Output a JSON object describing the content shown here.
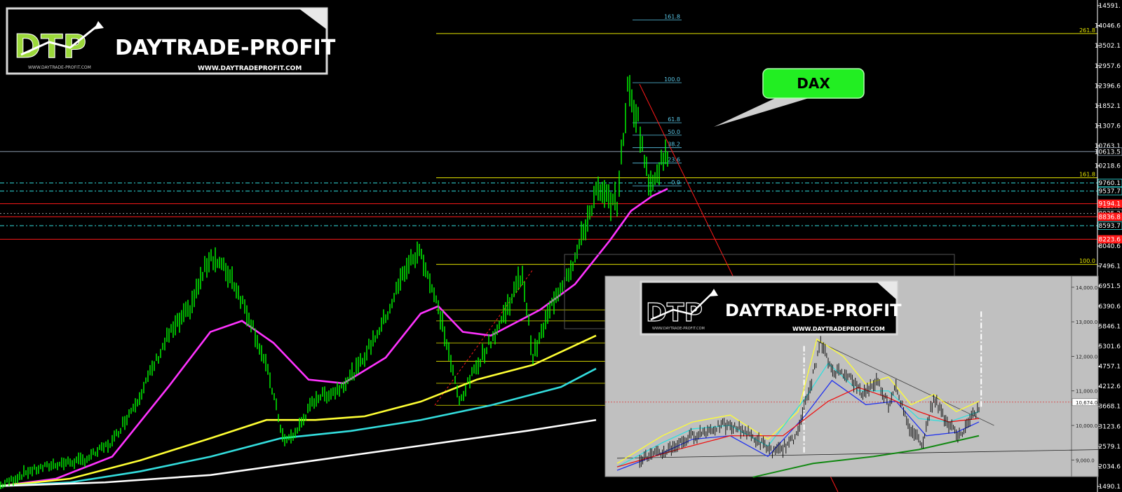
{
  "logo_main": {
    "mark": "DTP",
    "brand": "DAYTRADE-PROFIT",
    "url": "WWW.DAYTRADEPROFIT.COM",
    "small_url": "WWW.DAYTRADE-PROFIT.COM"
  },
  "logo_inset": {
    "mark": "DTP",
    "brand": "DAYTRADE-PROFIT",
    "url": "WWW.DAYTRADEPROFIT.COM",
    "small_url": "WWW.DAYTRADE-PROFIT.COM"
  },
  "callout": {
    "text": "DAX"
  },
  "colors": {
    "background": "#000000",
    "candles": "#00ff00",
    "ma_fast": "#ff33ff",
    "ma_mid": "#ffff33",
    "ma_slow": "#33dddd",
    "ma_long": "#ffffff",
    "fib_yellow": "#e8e800",
    "fib_cyan": "#5bc8e8",
    "support_cyan": "#33e0e0",
    "resistance_red": "#ff1a1a",
    "callout_green": "#22ee22",
    "inset_bg": "#c0c0c0"
  },
  "chart_data": [
    {
      "type": "line",
      "role": "main",
      "y_axis_ticks": [
        "14591.",
        "14046.6",
        "13502.1",
        "12957.6",
        "12396.6",
        "11852.1",
        "11307.6",
        "10763.1",
        "10218.6",
        "9674.1",
        "9129.6",
        "8585.1",
        "8040.6",
        "7496.1",
        "6951.5",
        "6390.6",
        "5846.1",
        "5301.6",
        "4757.1",
        "4212.6",
        "3668.1",
        "3123.6",
        "2579.1",
        "2034.6",
        "1490.1"
      ],
      "ylim": [
        1490.1,
        14591
      ],
      "price_badges": [
        {
          "label": "10613.5",
          "value": 10613.5,
          "kind": "current"
        },
        {
          "label": "9760.1",
          "value": 9760.1,
          "kind": "support"
        },
        {
          "label": "9537.7",
          "value": 9537.7,
          "kind": "support"
        },
        {
          "label": "9194.1",
          "value": 9194.1,
          "kind": "resistance"
        },
        {
          "label": "8925.2",
          "value": 8925.2,
          "kind": "other"
        },
        {
          "label": "8836.8",
          "value": 8836.8,
          "kind": "resistance"
        },
        {
          "label": "8593.7",
          "value": 8593.7,
          "kind": "support"
        },
        {
          "label": "8223.6",
          "value": 8223.6,
          "kind": "resistance"
        }
      ],
      "fib_labels_right": [
        {
          "label": "261.8",
          "value": 13830
        },
        {
          "label": "161.8",
          "value": 9900
        },
        {
          "label": "100.0",
          "value": 7540
        }
      ],
      "fib_labels_top": [
        {
          "label": "161.8",
          "value": 14200
        },
        {
          "label": "100.0",
          "value": 12490
        },
        {
          "label": "61.8",
          "value": 11400
        },
        {
          "label": "50.0",
          "value": 11060
        },
        {
          "label": "38.2",
          "value": 10720
        },
        {
          "label": "23.6",
          "value": 10300
        },
        {
          "label": "0.0",
          "value": 9680
        }
      ],
      "series": [
        {
          "color": "green",
          "values": [
            {
              "x": 0,
              "y": 1500
            },
            {
              "x": 40,
              "y": 1900
            },
            {
              "x": 80,
              "y": 2100
            },
            {
              "x": 120,
              "y": 2200
            },
            {
              "x": 160,
              "y": 2700
            },
            {
              "x": 200,
              "y": 4000
            },
            {
              "x": 240,
              "y": 5600
            },
            {
              "x": 270,
              "y": 6300
            },
            {
              "x": 300,
              "y": 7800
            },
            {
              "x": 330,
              "y": 7200
            },
            {
              "x": 360,
              "y": 5900
            },
            {
              "x": 385,
              "y": 4400
            },
            {
              "x": 405,
              "y": 2700
            },
            {
              "x": 420,
              "y": 2900
            },
            {
              "x": 450,
              "y": 3900
            },
            {
              "x": 480,
              "y": 4100
            },
            {
              "x": 510,
              "y": 4700
            },
            {
              "x": 550,
              "y": 6100
            },
            {
              "x": 580,
              "y": 7500
            },
            {
              "x": 600,
              "y": 7900
            },
            {
              "x": 630,
              "y": 6000
            },
            {
              "x": 655,
              "y": 3800
            },
            {
              "x": 680,
              "y": 4800
            },
            {
              "x": 710,
              "y": 5800
            },
            {
              "x": 745,
              "y": 7300
            },
            {
              "x": 760,
              "y": 5000
            },
            {
              "x": 790,
              "y": 6600
            },
            {
              "x": 820,
              "y": 7700
            },
            {
              "x": 850,
              "y": 9500
            },
            {
              "x": 880,
              "y": 9200
            },
            {
              "x": 895,
              "y": 12300
            },
            {
              "x": 910,
              "y": 11500
            },
            {
              "x": 925,
              "y": 9700
            },
            {
              "x": 940,
              "y": 10200
            },
            {
              "x": 952,
              "y": 10550
            }
          ]
        },
        {
          "color": "magenta",
          "values": [
            {
              "x": 0,
              "y": 1500
            },
            {
              "x": 80,
              "y": 1700
            },
            {
              "x": 160,
              "y": 2300
            },
            {
              "x": 240,
              "y": 4200
            },
            {
              "x": 300,
              "y": 5700
            },
            {
              "x": 345,
              "y": 6000
            },
            {
              "x": 390,
              "y": 5400
            },
            {
              "x": 440,
              "y": 4400
            },
            {
              "x": 490,
              "y": 4300
            },
            {
              "x": 550,
              "y": 5000
            },
            {
              "x": 600,
              "y": 6200
            },
            {
              "x": 625,
              "y": 6400
            },
            {
              "x": 660,
              "y": 5700
            },
            {
              "x": 700,
              "y": 5600
            },
            {
              "x": 740,
              "y": 6000
            },
            {
              "x": 770,
              "y": 6300
            },
            {
              "x": 820,
              "y": 7000
            },
            {
              "x": 870,
              "y": 8200
            },
            {
              "x": 900,
              "y": 9000
            },
            {
              "x": 930,
              "y": 9400
            },
            {
              "x": 952,
              "y": 9600
            }
          ]
        },
        {
          "color": "yellow",
          "values": [
            {
              "x": 0,
              "y": 1500
            },
            {
              "x": 100,
              "y": 1700
            },
            {
              "x": 200,
              "y": 2200
            },
            {
              "x": 300,
              "y": 2800
            },
            {
              "x": 380,
              "y": 3300
            },
            {
              "x": 450,
              "y": 3300
            },
            {
              "x": 520,
              "y": 3400
            },
            {
              "x": 600,
              "y": 3800
            },
            {
              "x": 680,
              "y": 4400
            },
            {
              "x": 760,
              "y": 4800
            },
            {
              "x": 850,
              "y": 5600
            }
          ]
        },
        {
          "color": "cyan",
          "values": [
            {
              "x": 0,
              "y": 1500
            },
            {
              "x": 100,
              "y": 1600
            },
            {
              "x": 200,
              "y": 1900
            },
            {
              "x": 300,
              "y": 2300
            },
            {
              "x": 400,
              "y": 2800
            },
            {
              "x": 500,
              "y": 3000
            },
            {
              "x": 600,
              "y": 3300
            },
            {
              "x": 700,
              "y": 3700
            },
            {
              "x": 800,
              "y": 4200
            },
            {
              "x": 850,
              "y": 4700
            }
          ]
        },
        {
          "color": "white",
          "values": [
            {
              "x": 0,
              "y": 1500
            },
            {
              "x": 150,
              "y": 1600
            },
            {
              "x": 300,
              "y": 1800
            },
            {
              "x": 450,
              "y": 2200
            },
            {
              "x": 600,
              "y": 2600
            },
            {
              "x": 750,
              "y": 3000
            },
            {
              "x": 850,
              "y": 3300
            }
          ]
        }
      ]
    },
    {
      "type": "line",
      "role": "inset",
      "y_axis_ticks": [
        "14,000.0",
        "13,000.0",
        "12,000.0",
        "11,000.0",
        "10,674.0",
        "10,000.0",
        "9,000.0"
      ],
      "ylim": [
        8600,
        14200
      ],
      "series": [
        {
          "color": "black",
          "values": [
            {
              "x": 0,
              "y": 8900
            },
            {
              "x": 60,
              "y": 9200
            },
            {
              "x": 100,
              "y": 9700
            },
            {
              "x": 140,
              "y": 10000
            },
            {
              "x": 165,
              "y": 9900
            },
            {
              "x": 190,
              "y": 9500
            },
            {
              "x": 210,
              "y": 9200
            },
            {
              "x": 235,
              "y": 9600
            },
            {
              "x": 255,
              "y": 11000
            },
            {
              "x": 270,
              "y": 12400
            },
            {
              "x": 285,
              "y": 11600
            },
            {
              "x": 305,
              "y": 11500
            },
            {
              "x": 325,
              "y": 10900
            },
            {
              "x": 345,
              "y": 11300
            },
            {
              "x": 360,
              "y": 10600
            },
            {
              "x": 370,
              "y": 11200
            },
            {
              "x": 385,
              "y": 10000
            },
            {
              "x": 405,
              "y": 9500
            },
            {
              "x": 420,
              "y": 10800
            },
            {
              "x": 440,
              "y": 10000
            },
            {
              "x": 455,
              "y": 9700
            },
            {
              "x": 470,
              "y": 10200
            },
            {
              "x": 480,
              "y": 10500
            }
          ]
        },
        {
          "color": "yellow",
          "values": [
            {
              "x": 0,
              "y": 8900
            },
            {
              "x": 60,
              "y": 9700
            },
            {
              "x": 100,
              "y": 10100
            },
            {
              "x": 150,
              "y": 10300
            },
            {
              "x": 200,
              "y": 9600
            },
            {
              "x": 240,
              "y": 10400
            },
            {
              "x": 265,
              "y": 12500
            },
            {
              "x": 300,
              "y": 12000
            },
            {
              "x": 330,
              "y": 11200
            },
            {
              "x": 360,
              "y": 11400
            },
            {
              "x": 390,
              "y": 10600
            },
            {
              "x": 420,
              "y": 10900
            },
            {
              "x": 450,
              "y": 10400
            },
            {
              "x": 480,
              "y": 10700
            }
          ]
        },
        {
          "color": "cyan",
          "values": [
            {
              "x": 0,
              "y": 8800
            },
            {
              "x": 60,
              "y": 9500
            },
            {
              "x": 100,
              "y": 9900
            },
            {
              "x": 150,
              "y": 10000
            },
            {
              "x": 200,
              "y": 9400
            },
            {
              "x": 250,
              "y": 10800
            },
            {
              "x": 280,
              "y": 11800
            },
            {
              "x": 320,
              "y": 11000
            },
            {
              "x": 360,
              "y": 11000
            },
            {
              "x": 400,
              "y": 10200
            },
            {
              "x": 440,
              "y": 10100
            },
            {
              "x": 480,
              "y": 10400
            }
          ]
        },
        {
          "color": "blue",
          "values": [
            {
              "x": 0,
              "y": 8700
            },
            {
              "x": 60,
              "y": 9200
            },
            {
              "x": 100,
              "y": 9600
            },
            {
              "x": 150,
              "y": 9700
            },
            {
              "x": 200,
              "y": 9100
            },
            {
              "x": 250,
              "y": 10300
            },
            {
              "x": 285,
              "y": 11300
            },
            {
              "x": 330,
              "y": 10600
            },
            {
              "x": 370,
              "y": 10700
            },
            {
              "x": 410,
              "y": 9700
            },
            {
              "x": 450,
              "y": 9800
            },
            {
              "x": 480,
              "y": 10100
            }
          ]
        },
        {
          "color": "red",
          "values": [
            {
              "x": 0,
              "y": 8800
            },
            {
              "x": 80,
              "y": 9300
            },
            {
              "x": 150,
              "y": 9700
            },
            {
              "x": 220,
              "y": 9700
            },
            {
              "x": 280,
              "y": 10700
            },
            {
              "x": 320,
              "y": 11100
            },
            {
              "x": 360,
              "y": 10800
            },
            {
              "x": 400,
              "y": 10400
            },
            {
              "x": 440,
              "y": 10100
            },
            {
              "x": 480,
              "y": 10200
            }
          ]
        },
        {
          "color": "green",
          "values": [
            {
              "x": 180,
              "y": 8500
            },
            {
              "x": 260,
              "y": 8900
            },
            {
              "x": 340,
              "y": 9100
            },
            {
              "x": 400,
              "y": 9300
            },
            {
              "x": 440,
              "y": 9500
            },
            {
              "x": 480,
              "y": 9700
            }
          ]
        }
      ]
    }
  ]
}
